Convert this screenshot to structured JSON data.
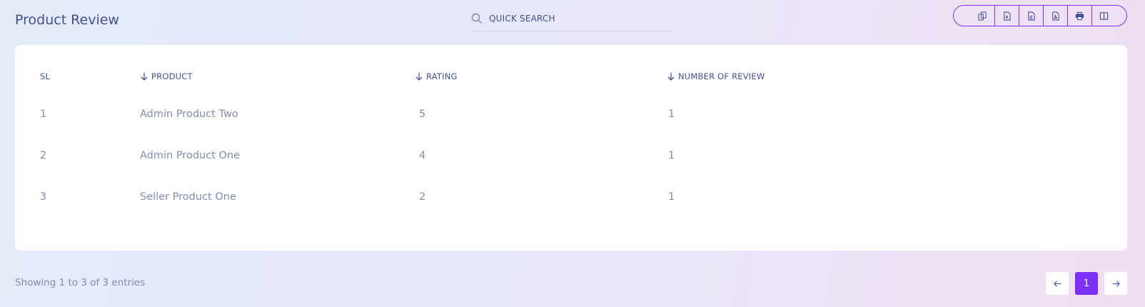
{
  "page": {
    "title": "Product Review"
  },
  "search": {
    "placeholder": "QUICK SEARCH",
    "icon": "search-icon"
  },
  "toolbar": {
    "buttons": [
      {
        "name": "copy",
        "icon": "copy-icon"
      },
      {
        "name": "excel",
        "icon": "file-excel-icon"
      },
      {
        "name": "csv",
        "icon": "file-text-icon"
      },
      {
        "name": "pdf",
        "icon": "file-pdf-icon"
      },
      {
        "name": "print",
        "icon": "print-icon"
      },
      {
        "name": "columns",
        "icon": "columns-icon"
      }
    ],
    "accent": "#7c32ff"
  },
  "table": {
    "columns": [
      "SL",
      "PRODUCT",
      "RATING",
      "NUMBER OF REVIEW"
    ],
    "rows": [
      {
        "sl": "1",
        "product": "Admin Product Two",
        "rating": "5",
        "reviews": "1"
      },
      {
        "sl": "2",
        "product": "Admin Product One",
        "rating": "4",
        "reviews": "1"
      },
      {
        "sl": "3",
        "product": "Seller Product One",
        "rating": "2",
        "reviews": "1"
      }
    ]
  },
  "footer": {
    "info": "Showing 1 to 3 of 3 entries",
    "current_page": "1"
  },
  "colors": {
    "primary_text": "#415094",
    "muted_text": "#828bb2",
    "accent": "#7c32ff"
  }
}
